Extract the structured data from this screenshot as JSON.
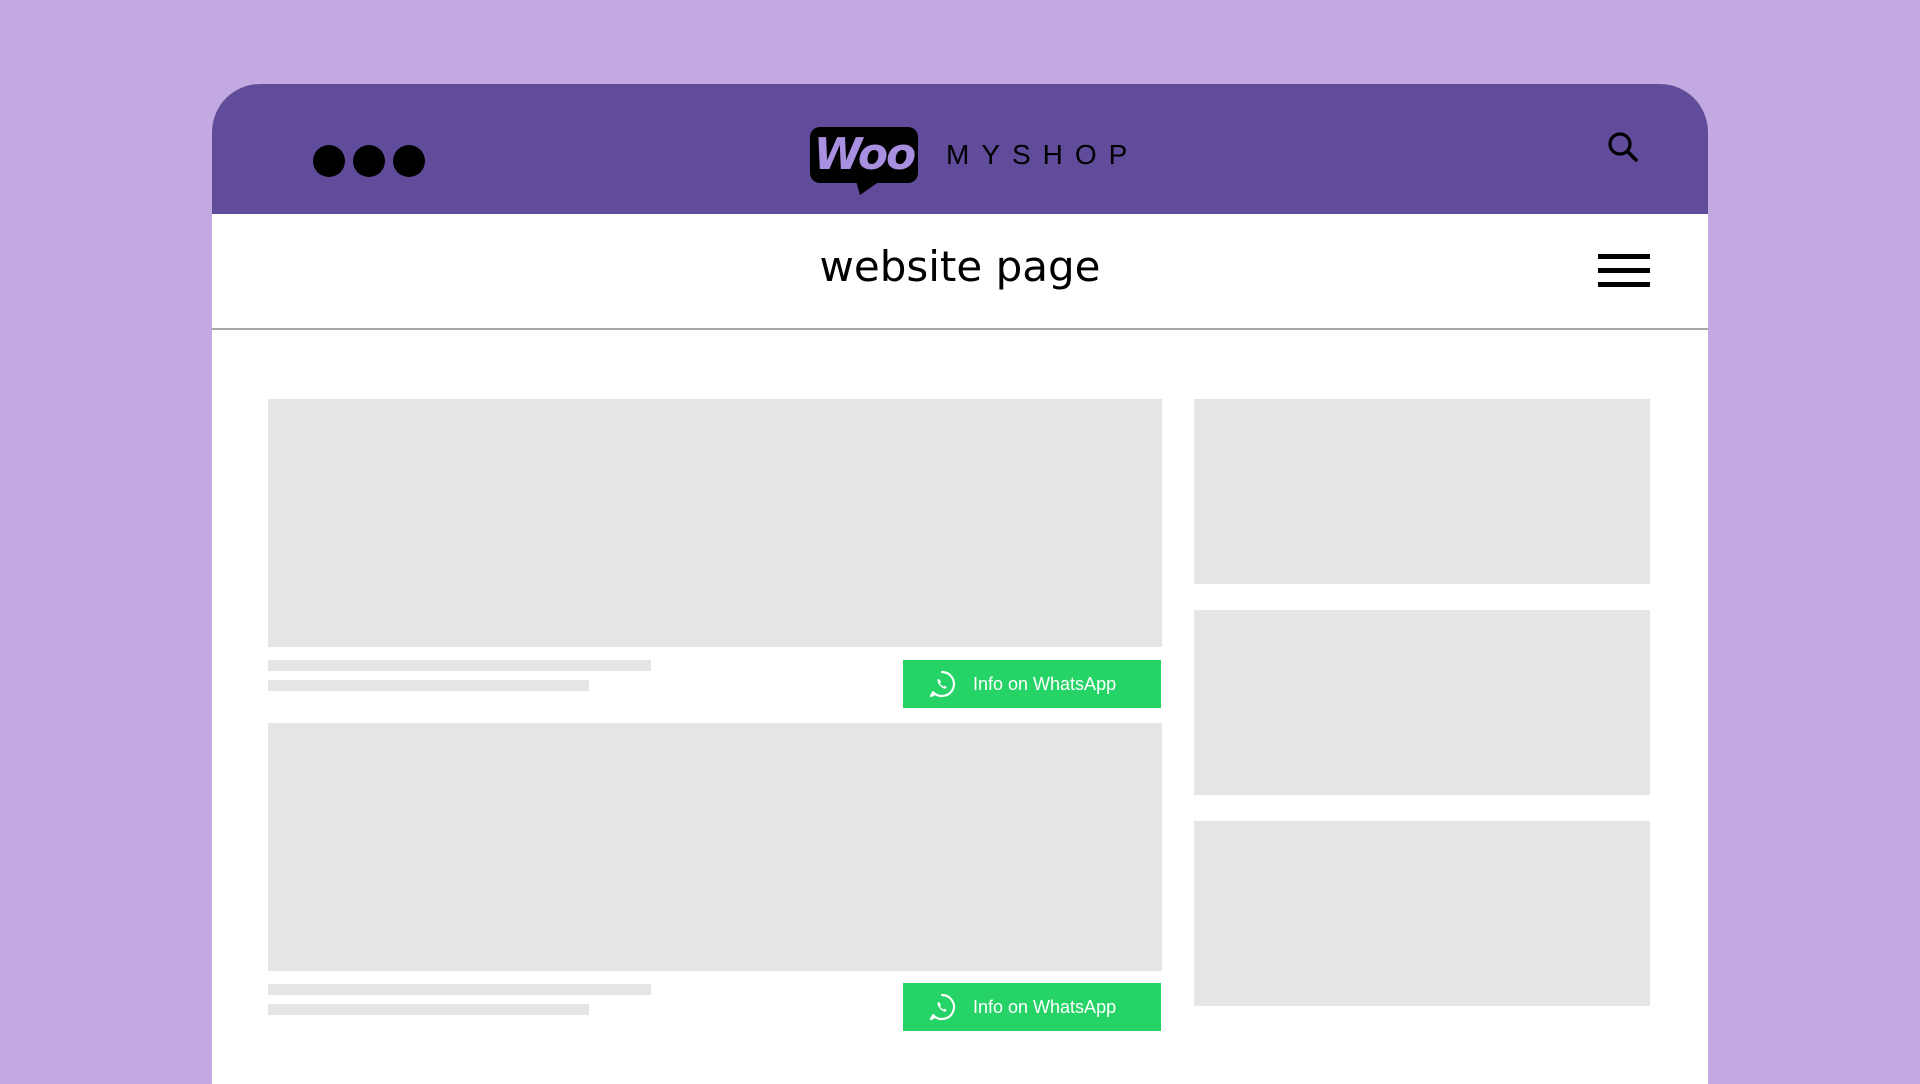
{
  "header": {
    "logo_text": "Woo",
    "shop_name": "MYSHOP"
  },
  "page": {
    "title": "website page"
  },
  "products": [
    {
      "button_label": "Info on WhatsApp"
    },
    {
      "button_label": "Info on WhatsApp"
    }
  ],
  "icons": {
    "window_controls": "three-dots-icon",
    "search": "search-icon",
    "menu": "hamburger-menu-icon",
    "whatsapp": "whatsapp-icon"
  },
  "colors": {
    "background": "#c3a9e1",
    "header": "#604c9a",
    "logo_text": "#a88fe0",
    "whatsapp_button": "#25d366",
    "placeholder": "#e5e5e5"
  }
}
